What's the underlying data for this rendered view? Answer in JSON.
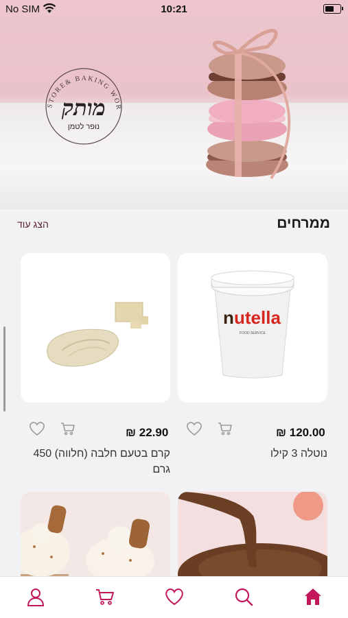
{
  "status_bar": {
    "carrier": "No SIM",
    "time": "10:21"
  },
  "hero": {
    "logo_name": "מותק",
    "logo_arc_text": "STORE& BAKING WORKSHOP",
    "logo_subtitle": "נופר לטמן"
  },
  "section": {
    "title": "ממרחים",
    "show_more": "הצג עוד"
  },
  "products": [
    {
      "name": "נוטלה 3 קילו",
      "price": "₪ 120.00",
      "image": "nutella-tub"
    },
    {
      "name": "קרם בטעם חלבה (חלווה) 450 גרם",
      "price": "₪ 22.90",
      "image": "halva-cream"
    },
    {
      "name": "",
      "price": "",
      "image": "chocolate-spread"
    },
    {
      "name": "",
      "price": "",
      "image": "lotus-cupcakes"
    }
  ],
  "colors": {
    "accent": "#c2185b",
    "brand_text": "#5a2030",
    "background": "#f2f2f4"
  },
  "tabbar": [
    {
      "icon": "home-icon",
      "active": true
    },
    {
      "icon": "search-icon",
      "active": false
    },
    {
      "icon": "heart-icon",
      "active": false
    },
    {
      "icon": "cart-icon",
      "active": false
    },
    {
      "icon": "user-icon",
      "active": false
    }
  ]
}
